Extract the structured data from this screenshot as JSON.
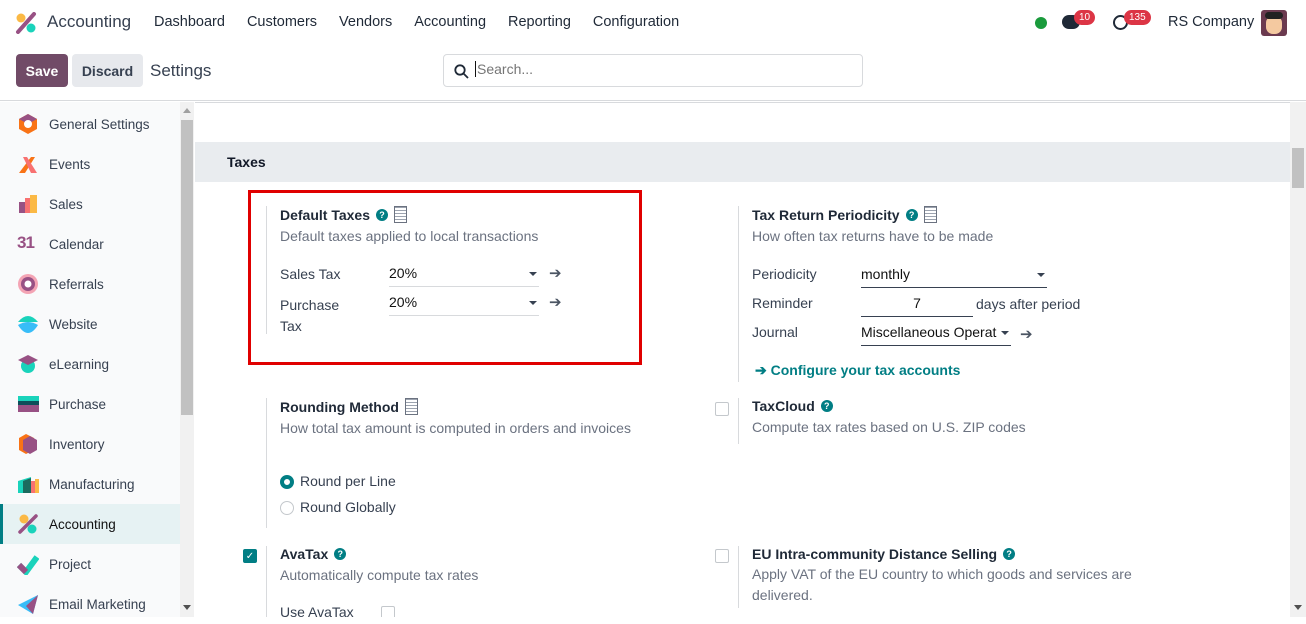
{
  "navbar": {
    "app_name": "Accounting",
    "menu": [
      "Dashboard",
      "Customers",
      "Vendors",
      "Accounting",
      "Reporting",
      "Configuration"
    ],
    "messages_count": "10",
    "activities_count": "135",
    "company": "RS Company",
    "status_color": "#1a9b3c"
  },
  "control_panel": {
    "save": "Save",
    "discard": "Discard",
    "title": "Settings",
    "search_placeholder": "Search..."
  },
  "sidebar": {
    "items": [
      {
        "label": "General Settings",
        "icon": "general-settings-icon"
      },
      {
        "label": "Events",
        "icon": "events-icon"
      },
      {
        "label": "Sales",
        "icon": "sales-icon"
      },
      {
        "label": "Calendar",
        "icon": "calendar-icon"
      },
      {
        "label": "Referrals",
        "icon": "referrals-icon"
      },
      {
        "label": "Website",
        "icon": "website-icon"
      },
      {
        "label": "eLearning",
        "icon": "elearning-icon"
      },
      {
        "label": "Purchase",
        "icon": "purchase-icon"
      },
      {
        "label": "Inventory",
        "icon": "inventory-icon"
      },
      {
        "label": "Manufacturing",
        "icon": "manufacturing-icon"
      },
      {
        "label": "Accounting",
        "icon": "accounting-icon",
        "active": true
      },
      {
        "label": "Project",
        "icon": "project-icon"
      },
      {
        "label": "Email Marketing",
        "icon": "email-marketing-icon"
      }
    ],
    "calendar_glyph": "31"
  },
  "taxes": {
    "header": "Taxes",
    "default_taxes": {
      "title": "Default Taxes",
      "desc": "Default taxes applied to local transactions",
      "sales_label": "Sales Tax",
      "sales_value": "20%",
      "purchase_label": "Purchase Tax",
      "purchase_value": "20%"
    },
    "periodicity": {
      "title": "Tax Return Periodicity",
      "desc": "How often tax returns have to be made",
      "periodicity_label": "Periodicity",
      "periodicity_value": "monthly",
      "reminder_label": "Reminder",
      "reminder_value": "7",
      "reminder_suffix": "days after period",
      "journal_label": "Journal",
      "journal_value": "Miscellaneous Operat",
      "configure_link": "Configure your tax accounts"
    },
    "rounding": {
      "title": "Rounding Method",
      "desc": "How total tax amount is computed in orders and invoices",
      "options": [
        "Round per Line",
        "Round Globally"
      ],
      "selected": "Round per Line"
    },
    "taxcloud": {
      "title": "TaxCloud",
      "desc": "Compute tax rates based on U.S. ZIP codes",
      "checked": false
    },
    "avatax": {
      "title": "AvaTax",
      "desc": "Automatically compute tax rates",
      "checked": true,
      "use_label": "Use AvaTax",
      "use_checked": false
    },
    "eu": {
      "title": "EU Intra-community Distance Selling",
      "desc": "Apply VAT of the EU country to which goods and services are delivered.",
      "checked": false
    }
  },
  "colors": {
    "primary": "#714b67",
    "accent": "#017e84",
    "highlight_box": "#e00000",
    "badge": "#dc3545"
  }
}
